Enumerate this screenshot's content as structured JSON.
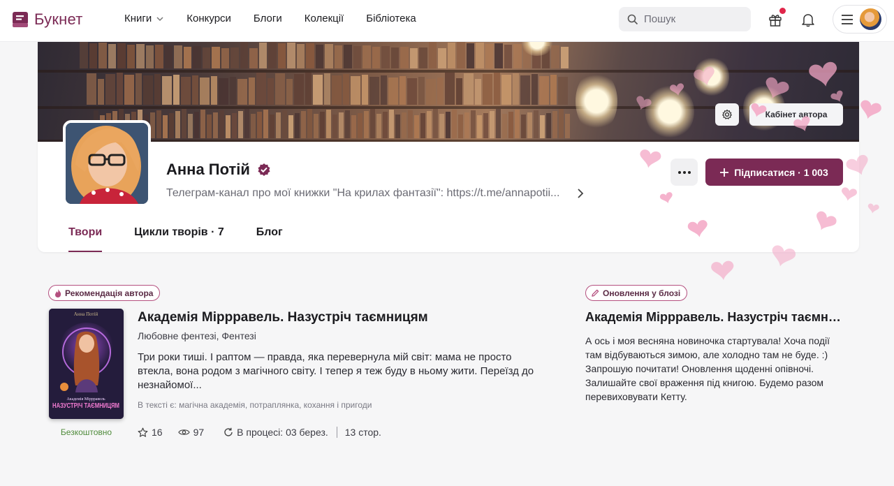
{
  "header": {
    "logo_text": "Букнет",
    "nav": [
      "Книги",
      "Конкурси",
      "Блоги",
      "Колекції",
      "Бібліотека"
    ],
    "search_placeholder": "Пошук"
  },
  "profile": {
    "cabinet_label": "Кабінет автора",
    "name": "Анна Потій",
    "bio": "Телеграм-канал про мої книжки \"На крилах фантазії\": https://t.me/annapotii...",
    "follow_label": "Підписатися · 1 003",
    "tabs": [
      "Твори",
      "Цикли творів · 7",
      "Блог"
    ]
  },
  "recommended": {
    "badge": "Рекомендація автора",
    "cover_author": "Анна Потій",
    "cover_series": "Академія Міррравель",
    "cover_title": "НАЗУСТРІЧ ТАЄМНИЦЯМ",
    "price": "Безкоштовно",
    "title": "Академія Міррравель. Назустріч таємницям",
    "genres": "Любовне фентезі, Фентезі",
    "annotation": "Три роки тиші. І раптом — правда, яка перевернула мій світ: мама не просто втекла, вона родом з магічного світу. І тепер я теж буду в ньому жити. Переїзд до незнайомої...",
    "tags_prefix": "В тексті є:",
    "tags": [
      "магічна академія",
      "потраплянка",
      "кохання і пригоди"
    ],
    "stars": "16",
    "views": "97",
    "status": "В процесі: 03 берез.",
    "pages": "13 стор."
  },
  "blog": {
    "badge": "Оновлення у блозі",
    "title": "Академія Міррравель. Назустріч таємниця...",
    "text": "А ось і моя весняна новиночка стартувала! Хоча події там відбуваються зимою, але холодно там не буде. :) Запрошую почитати! Оновлення щоденні опівночі. Залишайте свої враження під книгою. Будемо разом перевиховувати Кетту."
  },
  "colors": {
    "brand": "#7b2a55",
    "free": "#4e8a3a",
    "notification_dot": "#e0264a",
    "hearts": "#f3a6c4"
  }
}
